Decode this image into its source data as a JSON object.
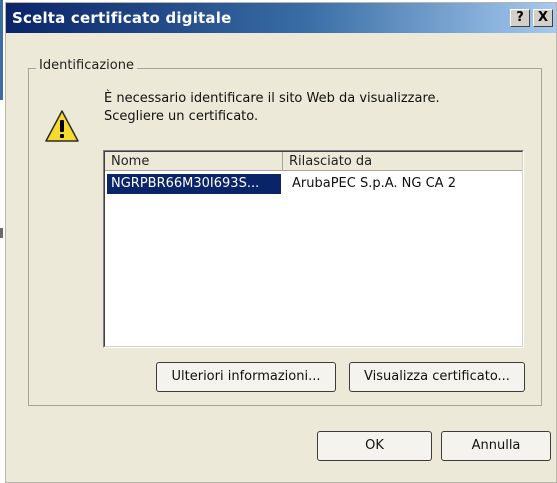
{
  "window": {
    "title": "Scelta certificato digitale",
    "help_label": "?",
    "close_label": "X"
  },
  "group": {
    "label": "Identificazione"
  },
  "message": {
    "line1": "È necessario identificare il sito Web da visualizzare.",
    "line2": "Scegliere un certificato."
  },
  "list": {
    "columns": [
      "Nome",
      "Rilasciato da"
    ],
    "rows": [
      {
        "name": "NGRPBR66M30I693S...",
        "issuer": "ArubaPEC S.p.A. NG CA 2",
        "selected": true
      }
    ]
  },
  "buttons": {
    "info": "Ulteriori informazioni...",
    "view": "Visualizza certificato...",
    "ok": "OK",
    "cancel": "Annulla"
  },
  "colors": {
    "title_start": "#0a246a",
    "title_end": "#a6caf0",
    "dialog_bg": "#ece9d8",
    "selection": "#0a246a"
  },
  "icons": {
    "warning": "warning-icon"
  }
}
